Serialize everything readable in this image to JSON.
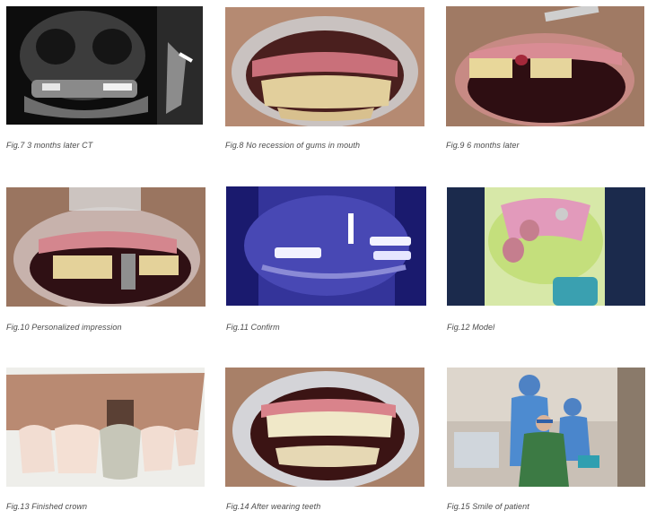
{
  "figures": [
    {
      "id": "fig7",
      "caption": "Fig.7  3 months later CT"
    },
    {
      "id": "fig8",
      "caption": "Fig.8  No recession of gums in mouth"
    },
    {
      "id": "fig9",
      "caption": "Fig.9  6 months later"
    },
    {
      "id": "fig10",
      "caption": "Fig.10  Personalized impression"
    },
    {
      "id": "fig11",
      "caption": "Fig.11  Confirm"
    },
    {
      "id": "fig12",
      "caption": "Fig.12  Model"
    },
    {
      "id": "fig13",
      "caption": "Fig.13  Finished crown"
    },
    {
      "id": "fig14",
      "caption": "Fig.14  After wearing teeth"
    },
    {
      "id": "fig15",
      "caption": "Fig.15  Smile of patient"
    }
  ]
}
